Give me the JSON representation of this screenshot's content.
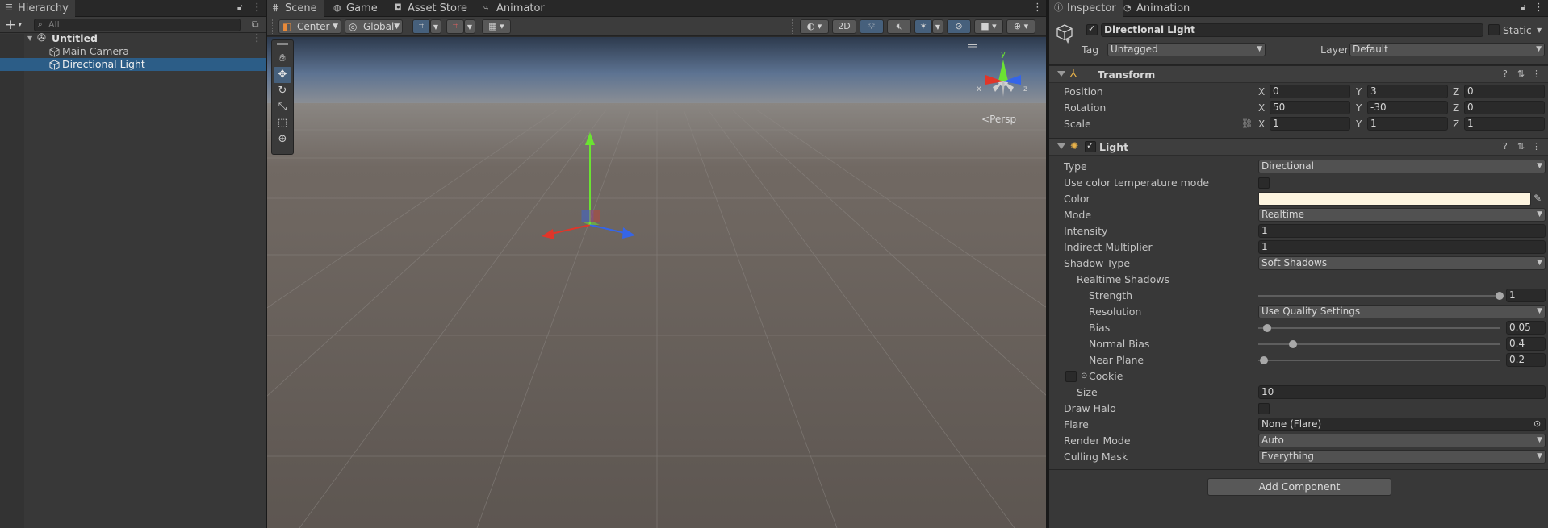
{
  "hierarchy": {
    "tab_label": "Hierarchy",
    "add_label": "+",
    "search_placeholder": "All",
    "scene_name": "Untitled",
    "items": [
      {
        "label": "Main Camera",
        "selected": false
      },
      {
        "label": "Directional Light",
        "selected": true
      }
    ]
  },
  "scene_view": {
    "tabs": [
      {
        "label": "Scene",
        "icon": "grid-icon",
        "active": true
      },
      {
        "label": "Game",
        "icon": "gamepad-icon",
        "active": false
      },
      {
        "label": "Asset Store",
        "icon": "bag-icon",
        "active": false
      },
      {
        "label": "Animator",
        "icon": "animator-icon",
        "active": false
      }
    ],
    "toolbar": {
      "pivot_label": "Center",
      "space_label": "Global",
      "mode_2d_label": "2D"
    },
    "gizmo": {
      "y_label": "y",
      "x_label": "x",
      "z_label": "z",
      "projection_label": "Persp"
    }
  },
  "inspector": {
    "tabs": [
      {
        "label": "Inspector",
        "active": true
      },
      {
        "label": "Animation",
        "active": false
      }
    ],
    "object_name": "Directional Light",
    "static_label": "Static",
    "tag_label": "Tag",
    "tag_value": "Untagged",
    "layer_label": "Layer",
    "layer_value": "Default",
    "transform": {
      "title": "Transform",
      "position": {
        "label": "Position",
        "x": "0",
        "y": "3",
        "z": "0"
      },
      "rotation": {
        "label": "Rotation",
        "x": "50",
        "y": "-30",
        "z": "0"
      },
      "scale": {
        "label": "Scale",
        "x": "1",
        "y": "1",
        "z": "1"
      }
    },
    "light": {
      "title": "Light",
      "type_label": "Type",
      "type_value": "Directional",
      "use_temp_label": "Use color temperature mode",
      "color_label": "Color",
      "color_value": "#FDF4DF",
      "mode_label": "Mode",
      "mode_value": "Realtime",
      "intensity_label": "Intensity",
      "intensity_value": "1",
      "indirect_label": "Indirect Multiplier",
      "indirect_value": "1",
      "shadow_type_label": "Shadow Type",
      "shadow_type_value": "Soft Shadows",
      "realtime_shadows_label": "Realtime Shadows",
      "strength_label": "Strength",
      "strength_value": "1",
      "resolution_label": "Resolution",
      "resolution_value": "Use Quality Settings",
      "bias_label": "Bias",
      "bias_value": "0.05",
      "normal_bias_label": "Normal Bias",
      "normal_bias_value": "0.4",
      "near_plane_label": "Near Plane",
      "near_plane_value": "0.2",
      "cookie_label": "Cookie",
      "size_label": "Size",
      "size_value": "10",
      "draw_halo_label": "Draw Halo",
      "flare_label": "Flare",
      "flare_value": "None (Flare)",
      "render_mode_label": "Render Mode",
      "render_mode_value": "Auto",
      "culling_label": "Culling Mask",
      "culling_value": "Everything"
    },
    "add_component_label": "Add Component"
  },
  "colors": {
    "selection": "#2C5D87",
    "panel": "#383838",
    "x_axis": "#E0362A",
    "y_axis": "#6BE332",
    "z_axis": "#3565E8"
  }
}
